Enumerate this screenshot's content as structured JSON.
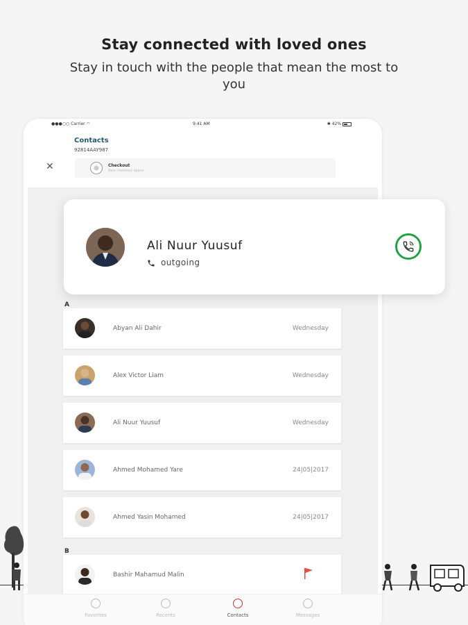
{
  "headline": "Stay connected with loved ones",
  "subline": "Stay in touch with the people that mean the most to you",
  "tablet": {
    "status_bar": {
      "carrier": "Carrier",
      "time": "9:41 AM",
      "battery": "42%"
    },
    "title": "Contacts",
    "subtitle": "92814AAY987",
    "close_icon": "close-icon",
    "checkout": {
      "title": "Checkout",
      "subtitle": "New checkout space"
    },
    "sections": [
      {
        "letter": "A",
        "contacts": [
          {
            "name": "Abyan Ali Dahir",
            "when": "Wednesday"
          },
          {
            "name": "Alex Victor Liam",
            "when": "Wednesday"
          },
          {
            "name": "Ali Nuur Yuusuf",
            "when": "Wednesday"
          },
          {
            "name": "Ahmed Mohamed Yare",
            "when": "24|05|2017"
          },
          {
            "name": "Ahmed Yasin Mohamed",
            "when": "24|05|2017"
          }
        ]
      },
      {
        "letter": "B",
        "contacts": [
          {
            "name": "Bashir Mahamud Malin",
            "when": "",
            "flag_color": "#e74c3c"
          }
        ]
      }
    ],
    "tabs": [
      {
        "label": "Favorites",
        "icon": "star-icon",
        "active": false
      },
      {
        "label": "Recents",
        "icon": "clock-icon",
        "active": false
      },
      {
        "label": "Contacts",
        "icon": "contacts-icon",
        "active": true
      },
      {
        "label": "Messages",
        "icon": "message-icon",
        "active": false
      }
    ]
  },
  "call_card": {
    "name": "Ali Nuur Yuusuf",
    "status": "outgoing",
    "status_icon": "phone-icon",
    "call_button_color": "#1fa33f"
  },
  "colors": {
    "accent": "#1e5a6e",
    "call_green": "#1fa33f",
    "active_tab": "#c0392b"
  }
}
